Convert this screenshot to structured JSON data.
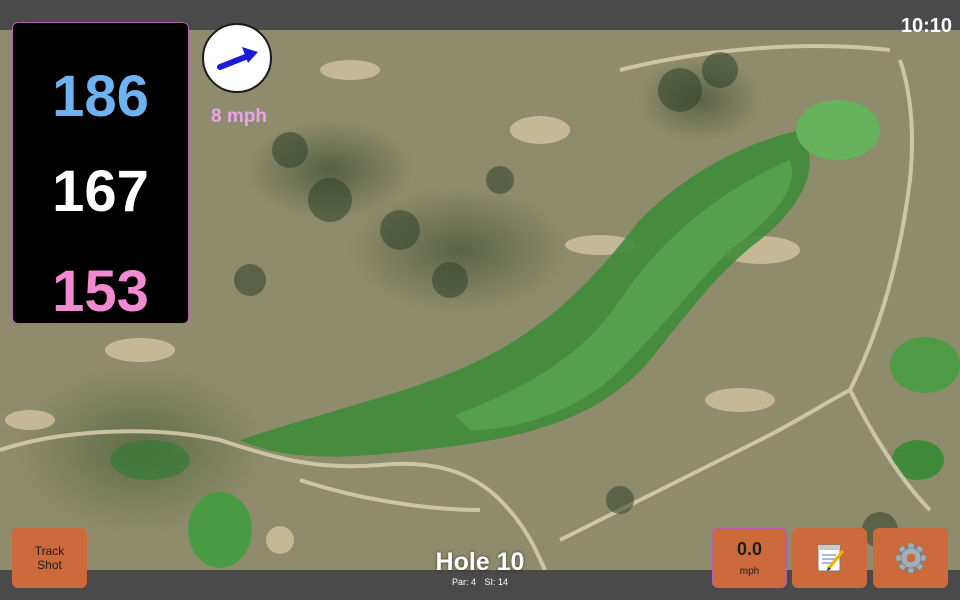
{
  "status_bar": {
    "time": "10:10"
  },
  "distances": {
    "back": "186",
    "middle": "167",
    "front": "153"
  },
  "wind": {
    "speed": "8 mph",
    "icon": "wind-arrow-icon"
  },
  "track_button": {
    "line1": "Track",
    "line2": "Shot"
  },
  "speed": {
    "value": "0.0",
    "unit": "mph"
  },
  "notes_button": {
    "icon": "notepad-icon"
  },
  "settings_button": {
    "icon": "gear-icon"
  },
  "hole": {
    "title": "Hole 10",
    "par": "Par: 4",
    "si": "SI: 14"
  },
  "colors": {
    "back": "#6fb2f2",
    "middle": "#ffffff",
    "front": "#f18ad0",
    "wind_text": "#e7a6ea",
    "button": "#cc6a3c",
    "accent_border": "#b25fb0"
  }
}
